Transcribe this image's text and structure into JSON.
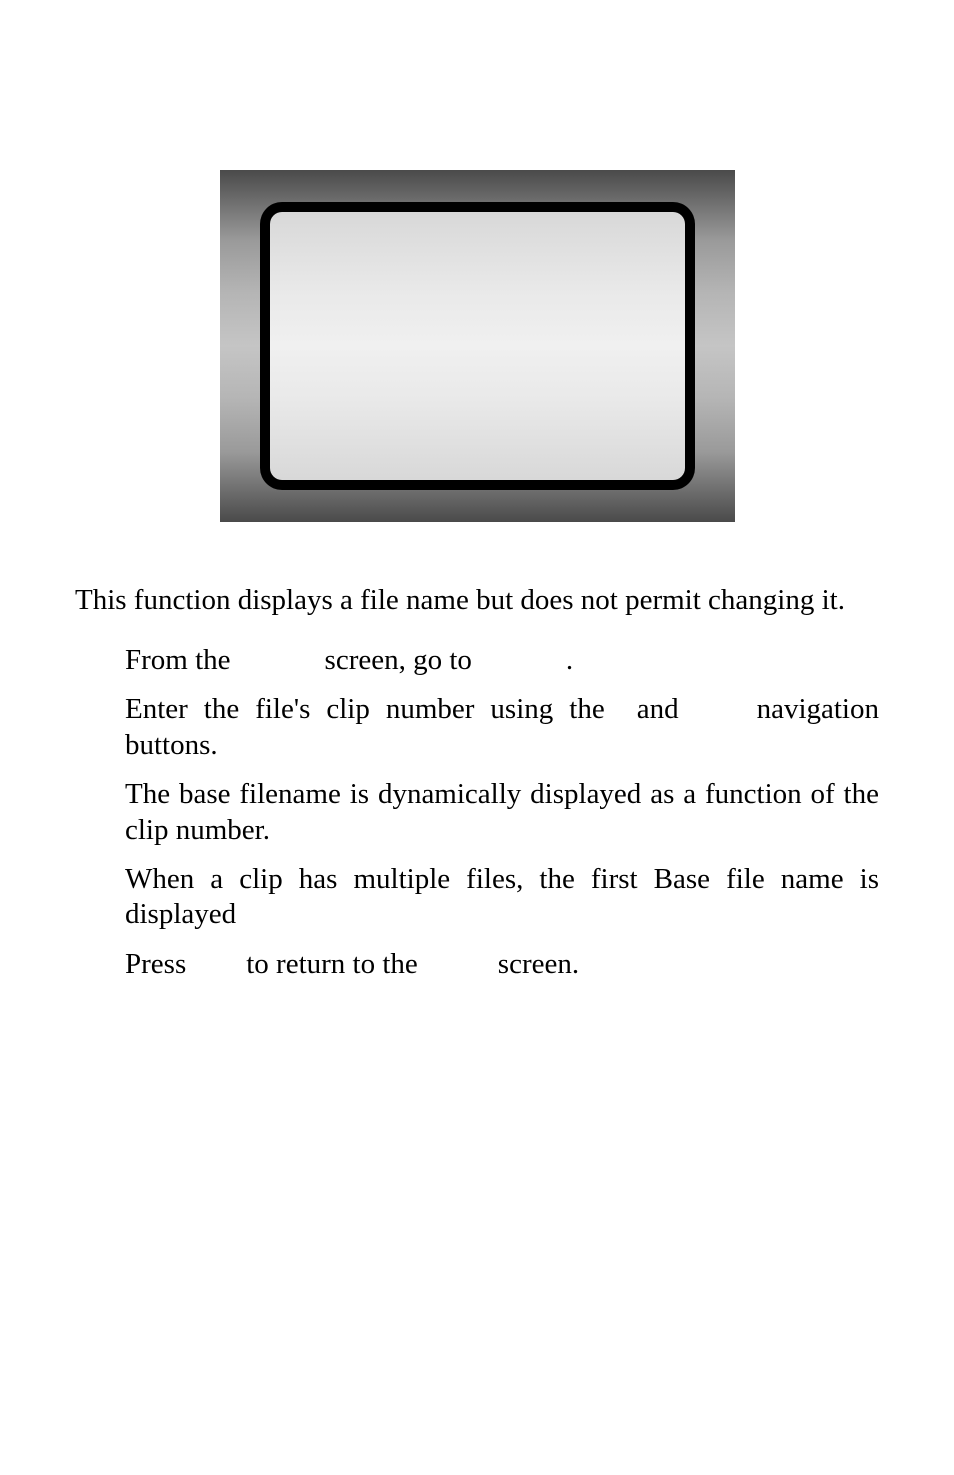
{
  "intro": "This function displays a file name but does not permit changing it.",
  "steps": {
    "s1a": "From the",
    "s1b": "screen, go to",
    "s1c": ".",
    "s2a": "Enter the file's clip number using the",
    "s2b": "and",
    "s2c": "navigation buttons.",
    "s3": "The base filename is dynamically displayed as a function of the clip number.",
    "s4": "When a clip has multiple files, the first Base file name is displayed",
    "s5a": "Press",
    "s5b": "to return to the",
    "s5c": "screen."
  }
}
